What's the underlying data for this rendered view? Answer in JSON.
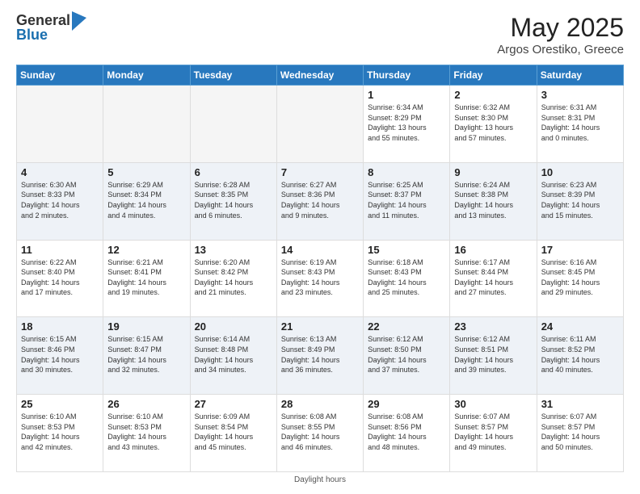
{
  "logo": {
    "general": "General",
    "blue": "Blue"
  },
  "title": "May 2025",
  "subtitle": "Argos Orestiko, Greece",
  "footer": "Daylight hours",
  "headers": [
    "Sunday",
    "Monday",
    "Tuesday",
    "Wednesday",
    "Thursday",
    "Friday",
    "Saturday"
  ],
  "weeks": [
    [
      {
        "num": "",
        "info": ""
      },
      {
        "num": "",
        "info": ""
      },
      {
        "num": "",
        "info": ""
      },
      {
        "num": "",
        "info": ""
      },
      {
        "num": "1",
        "info": "Sunrise: 6:34 AM\nSunset: 8:29 PM\nDaylight: 13 hours\nand 55 minutes."
      },
      {
        "num": "2",
        "info": "Sunrise: 6:32 AM\nSunset: 8:30 PM\nDaylight: 13 hours\nand 57 minutes."
      },
      {
        "num": "3",
        "info": "Sunrise: 6:31 AM\nSunset: 8:31 PM\nDaylight: 14 hours\nand 0 minutes."
      }
    ],
    [
      {
        "num": "4",
        "info": "Sunrise: 6:30 AM\nSunset: 8:33 PM\nDaylight: 14 hours\nand 2 minutes."
      },
      {
        "num": "5",
        "info": "Sunrise: 6:29 AM\nSunset: 8:34 PM\nDaylight: 14 hours\nand 4 minutes."
      },
      {
        "num": "6",
        "info": "Sunrise: 6:28 AM\nSunset: 8:35 PM\nDaylight: 14 hours\nand 6 minutes."
      },
      {
        "num": "7",
        "info": "Sunrise: 6:27 AM\nSunset: 8:36 PM\nDaylight: 14 hours\nand 9 minutes."
      },
      {
        "num": "8",
        "info": "Sunrise: 6:25 AM\nSunset: 8:37 PM\nDaylight: 14 hours\nand 11 minutes."
      },
      {
        "num": "9",
        "info": "Sunrise: 6:24 AM\nSunset: 8:38 PM\nDaylight: 14 hours\nand 13 minutes."
      },
      {
        "num": "10",
        "info": "Sunrise: 6:23 AM\nSunset: 8:39 PM\nDaylight: 14 hours\nand 15 minutes."
      }
    ],
    [
      {
        "num": "11",
        "info": "Sunrise: 6:22 AM\nSunset: 8:40 PM\nDaylight: 14 hours\nand 17 minutes."
      },
      {
        "num": "12",
        "info": "Sunrise: 6:21 AM\nSunset: 8:41 PM\nDaylight: 14 hours\nand 19 minutes."
      },
      {
        "num": "13",
        "info": "Sunrise: 6:20 AM\nSunset: 8:42 PM\nDaylight: 14 hours\nand 21 minutes."
      },
      {
        "num": "14",
        "info": "Sunrise: 6:19 AM\nSunset: 8:43 PM\nDaylight: 14 hours\nand 23 minutes."
      },
      {
        "num": "15",
        "info": "Sunrise: 6:18 AM\nSunset: 8:43 PM\nDaylight: 14 hours\nand 25 minutes."
      },
      {
        "num": "16",
        "info": "Sunrise: 6:17 AM\nSunset: 8:44 PM\nDaylight: 14 hours\nand 27 minutes."
      },
      {
        "num": "17",
        "info": "Sunrise: 6:16 AM\nSunset: 8:45 PM\nDaylight: 14 hours\nand 29 minutes."
      }
    ],
    [
      {
        "num": "18",
        "info": "Sunrise: 6:15 AM\nSunset: 8:46 PM\nDaylight: 14 hours\nand 30 minutes."
      },
      {
        "num": "19",
        "info": "Sunrise: 6:15 AM\nSunset: 8:47 PM\nDaylight: 14 hours\nand 32 minutes."
      },
      {
        "num": "20",
        "info": "Sunrise: 6:14 AM\nSunset: 8:48 PM\nDaylight: 14 hours\nand 34 minutes."
      },
      {
        "num": "21",
        "info": "Sunrise: 6:13 AM\nSunset: 8:49 PM\nDaylight: 14 hours\nand 36 minutes."
      },
      {
        "num": "22",
        "info": "Sunrise: 6:12 AM\nSunset: 8:50 PM\nDaylight: 14 hours\nand 37 minutes."
      },
      {
        "num": "23",
        "info": "Sunrise: 6:12 AM\nSunset: 8:51 PM\nDaylight: 14 hours\nand 39 minutes."
      },
      {
        "num": "24",
        "info": "Sunrise: 6:11 AM\nSunset: 8:52 PM\nDaylight: 14 hours\nand 40 minutes."
      }
    ],
    [
      {
        "num": "25",
        "info": "Sunrise: 6:10 AM\nSunset: 8:53 PM\nDaylight: 14 hours\nand 42 minutes."
      },
      {
        "num": "26",
        "info": "Sunrise: 6:10 AM\nSunset: 8:53 PM\nDaylight: 14 hours\nand 43 minutes."
      },
      {
        "num": "27",
        "info": "Sunrise: 6:09 AM\nSunset: 8:54 PM\nDaylight: 14 hours\nand 45 minutes."
      },
      {
        "num": "28",
        "info": "Sunrise: 6:08 AM\nSunset: 8:55 PM\nDaylight: 14 hours\nand 46 minutes."
      },
      {
        "num": "29",
        "info": "Sunrise: 6:08 AM\nSunset: 8:56 PM\nDaylight: 14 hours\nand 48 minutes."
      },
      {
        "num": "30",
        "info": "Sunrise: 6:07 AM\nSunset: 8:57 PM\nDaylight: 14 hours\nand 49 minutes."
      },
      {
        "num": "31",
        "info": "Sunrise: 6:07 AM\nSunset: 8:57 PM\nDaylight: 14 hours\nand 50 minutes."
      }
    ]
  ]
}
